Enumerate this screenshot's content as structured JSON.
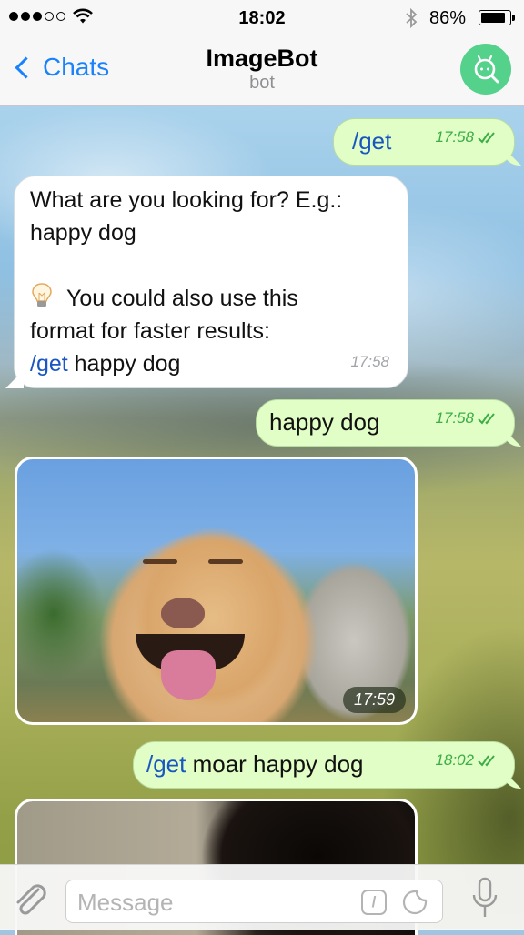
{
  "status_bar": {
    "signal_filled": 3,
    "signal_total": 5,
    "time": "18:02",
    "bluetooth_icon": "bluetooth-icon",
    "battery_percent_label": "86%",
    "battery_level": 0.86
  },
  "nav": {
    "back_label": "Chats",
    "title": "ImageBot",
    "subtitle": "bot",
    "avatar_icon": "bot-search-icon",
    "colors": {
      "accent": "#1a82fb",
      "avatar_bg": "#54d18a"
    }
  },
  "messages": [
    {
      "direction": "out",
      "command": "/get",
      "text": "",
      "time": "17:58",
      "status": "read"
    },
    {
      "direction": "in",
      "lines": [
        "What are you looking for? E.g.:",
        "happy dog",
        "",
        "You could also use this",
        "format for faster results:"
      ],
      "hint_icon": "lightbulb-icon",
      "example_command": "/get",
      "example_text": " happy dog",
      "time": "17:58"
    },
    {
      "direction": "out",
      "command": "",
      "text": "happy dog",
      "time": "17:58",
      "status": "read"
    },
    {
      "direction": "in",
      "type": "photo",
      "description": "smiling yellow labrador dog",
      "time": "17:59"
    },
    {
      "direction": "out",
      "command": "/get",
      "text": " moar happy dog",
      "time": "18:02",
      "status": "read"
    },
    {
      "direction": "in",
      "type": "photo",
      "description": "black dog partially visible",
      "time": ""
    }
  ],
  "composer": {
    "placeholder": "Message",
    "value": "",
    "attach_icon": "paperclip-icon",
    "command_icon": "slash-command-icon",
    "command_glyph": "/",
    "sticker_icon": "sticker-icon",
    "mic_icon": "microphone-icon"
  },
  "colors": {
    "outgoing_bubble": "#e1fec6",
    "incoming_bubble": "#ffffff",
    "command_link": "#1a56c2",
    "outgoing_time": "#3cae44"
  }
}
